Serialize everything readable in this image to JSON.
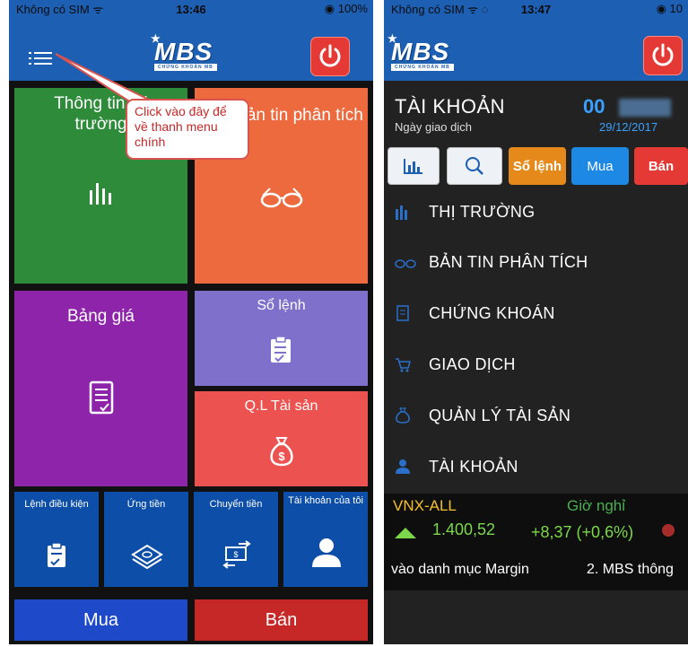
{
  "left": {
    "status": {
      "carrier": "Không có SIM ᯤ",
      "time": "13:46",
      "battery": "◉ 100%"
    },
    "logo": {
      "main": "MBS",
      "sub": "CHỨNG KHOÁN MB"
    },
    "tiles": {
      "market": "Thông tin thị trường",
      "analysis": "Bản tin phân tích",
      "pricetable": "Bảng giá",
      "orderbook": "Sổ lệnh",
      "assets": "Q.L Tài sản",
      "condorder": "Lệnh điều kiện",
      "advance": "Ứng tiền",
      "transfer": "Chuyển tiền",
      "myaccount": "Tài khoản của tôi",
      "buy": "Mua",
      "sell": "Bán"
    },
    "callout": "Click vào đây để về thanh menu chính"
  },
  "right": {
    "status": {
      "carrier": "Không có SIM ᯤ ◌",
      "time": "13:47",
      "battery": "◉ 10"
    },
    "logo": {
      "main": "MBS",
      "sub": "CHỨNG KHOÁN MB"
    },
    "header": {
      "title": "TÀI KHOẢN",
      "account": "00",
      "date_label": "Ngày giao dịch",
      "date": "29/12/2017"
    },
    "toolbar": {
      "orderbook": "Sổ lệnh",
      "buy": "Mua",
      "sell": "Bán"
    },
    "menu": [
      {
        "label": "THỊ TRƯỜNG",
        "icon": "chart-bars-icon"
      },
      {
        "label": "BẢN TIN PHÂN TÍCH",
        "icon": "glasses-icon"
      },
      {
        "label": "CHỨNG KHOÁN",
        "icon": "document-icon"
      },
      {
        "label": "GIAO DỊCH",
        "icon": "cart-icon"
      },
      {
        "label": "QUẢN LÝ TÀI SẢN",
        "icon": "money-bag-icon"
      },
      {
        "label": "TÀI KHOẢN",
        "icon": "user-icon"
      }
    ],
    "ticker": {
      "index": "VNX-ALL",
      "status": "Giờ nghỉ",
      "value": "1.400,52",
      "change": "+8,37 (+0,6%)"
    },
    "marquee": {
      "item1": "vào danh mục Margin",
      "item2": "2. MBS thông"
    }
  },
  "colors": {
    "brand": "#1d5fb3",
    "green": "#2e7d32",
    "orange": "#e8623a",
    "purple": "#7b1fa2",
    "lavender": "#7e6fc9",
    "red": "#e53935",
    "navy": "#0d47a1",
    "up": "#7cd84a"
  }
}
